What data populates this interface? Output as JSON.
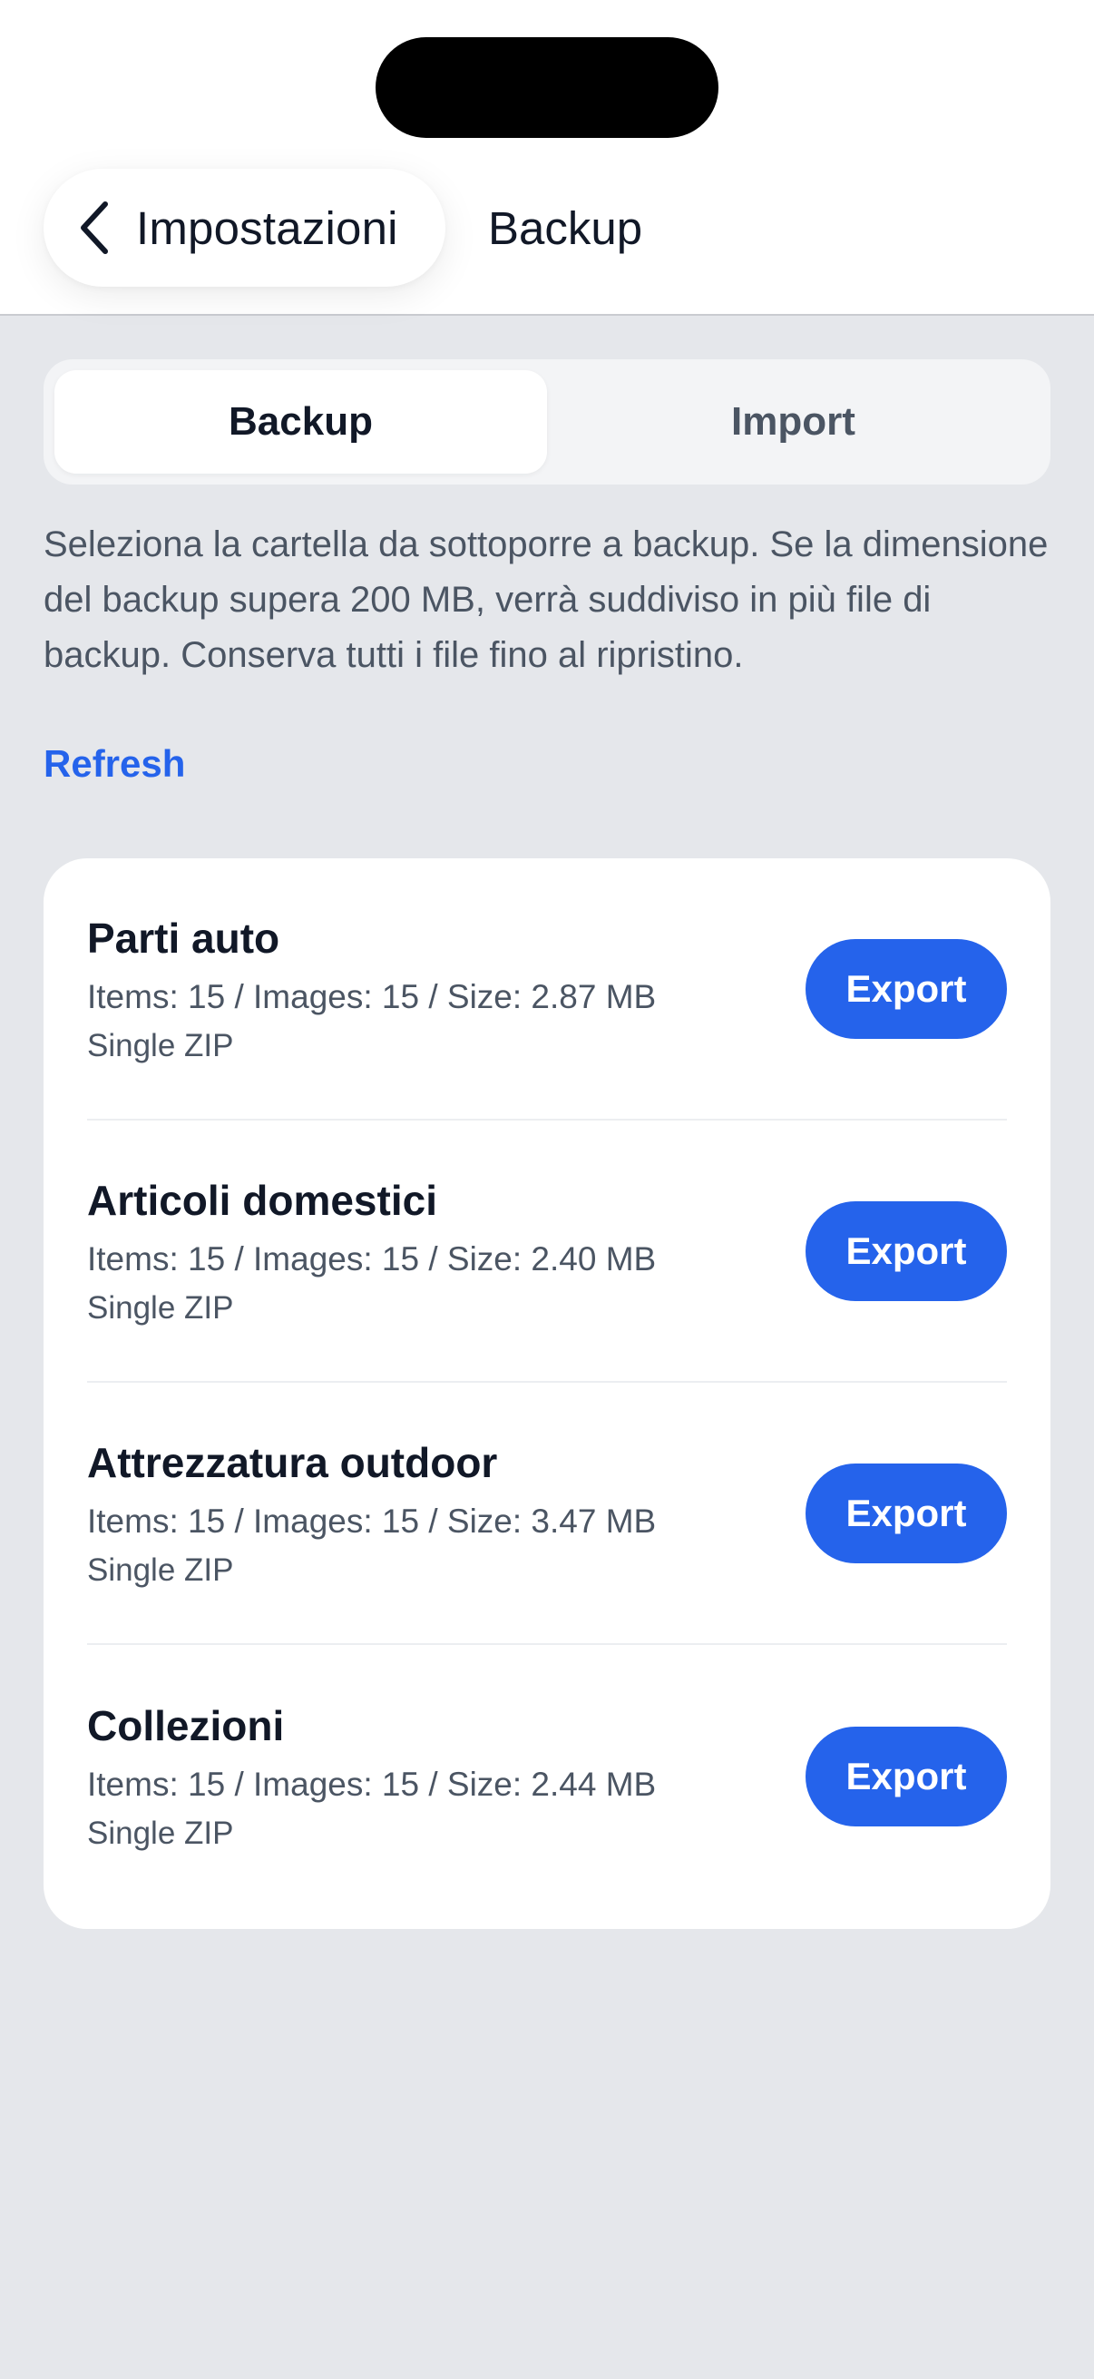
{
  "nav": {
    "back_label": "Impostazioni",
    "title": "Backup"
  },
  "tabs": [
    {
      "label": "Backup",
      "active": true
    },
    {
      "label": "Import",
      "active": false
    }
  ],
  "description": "Seleziona la cartella da sottoporre a backup. Se la dimensione del backup supera 200 MB, verrà suddiviso in più file di backup. Conserva tutti i file fino al ripristino.",
  "refresh_label": "Refresh",
  "folders": [
    {
      "name": "Parti auto",
      "meta": "Items: 15 / Images: 15 / Size: 2.87 MB",
      "format": "Single ZIP",
      "action": "Export"
    },
    {
      "name": "Articoli domestici",
      "meta": "Items: 15 / Images: 15 / Size: 2.40 MB",
      "format": "Single ZIP",
      "action": "Export"
    },
    {
      "name": "Attrezzatura outdoor",
      "meta": "Items: 15 / Images: 15 / Size: 3.47 MB",
      "format": "Single ZIP",
      "action": "Export"
    },
    {
      "name": "Collezioni",
      "meta": "Items: 15 / Images: 15 / Size: 2.44 MB",
      "format": "Single ZIP",
      "action": "Export"
    }
  ],
  "colors": {
    "accent": "#2563eb",
    "background": "#e5e7eb",
    "card": "#ffffff"
  },
  "icons": {
    "back": "chevron-left-icon"
  }
}
